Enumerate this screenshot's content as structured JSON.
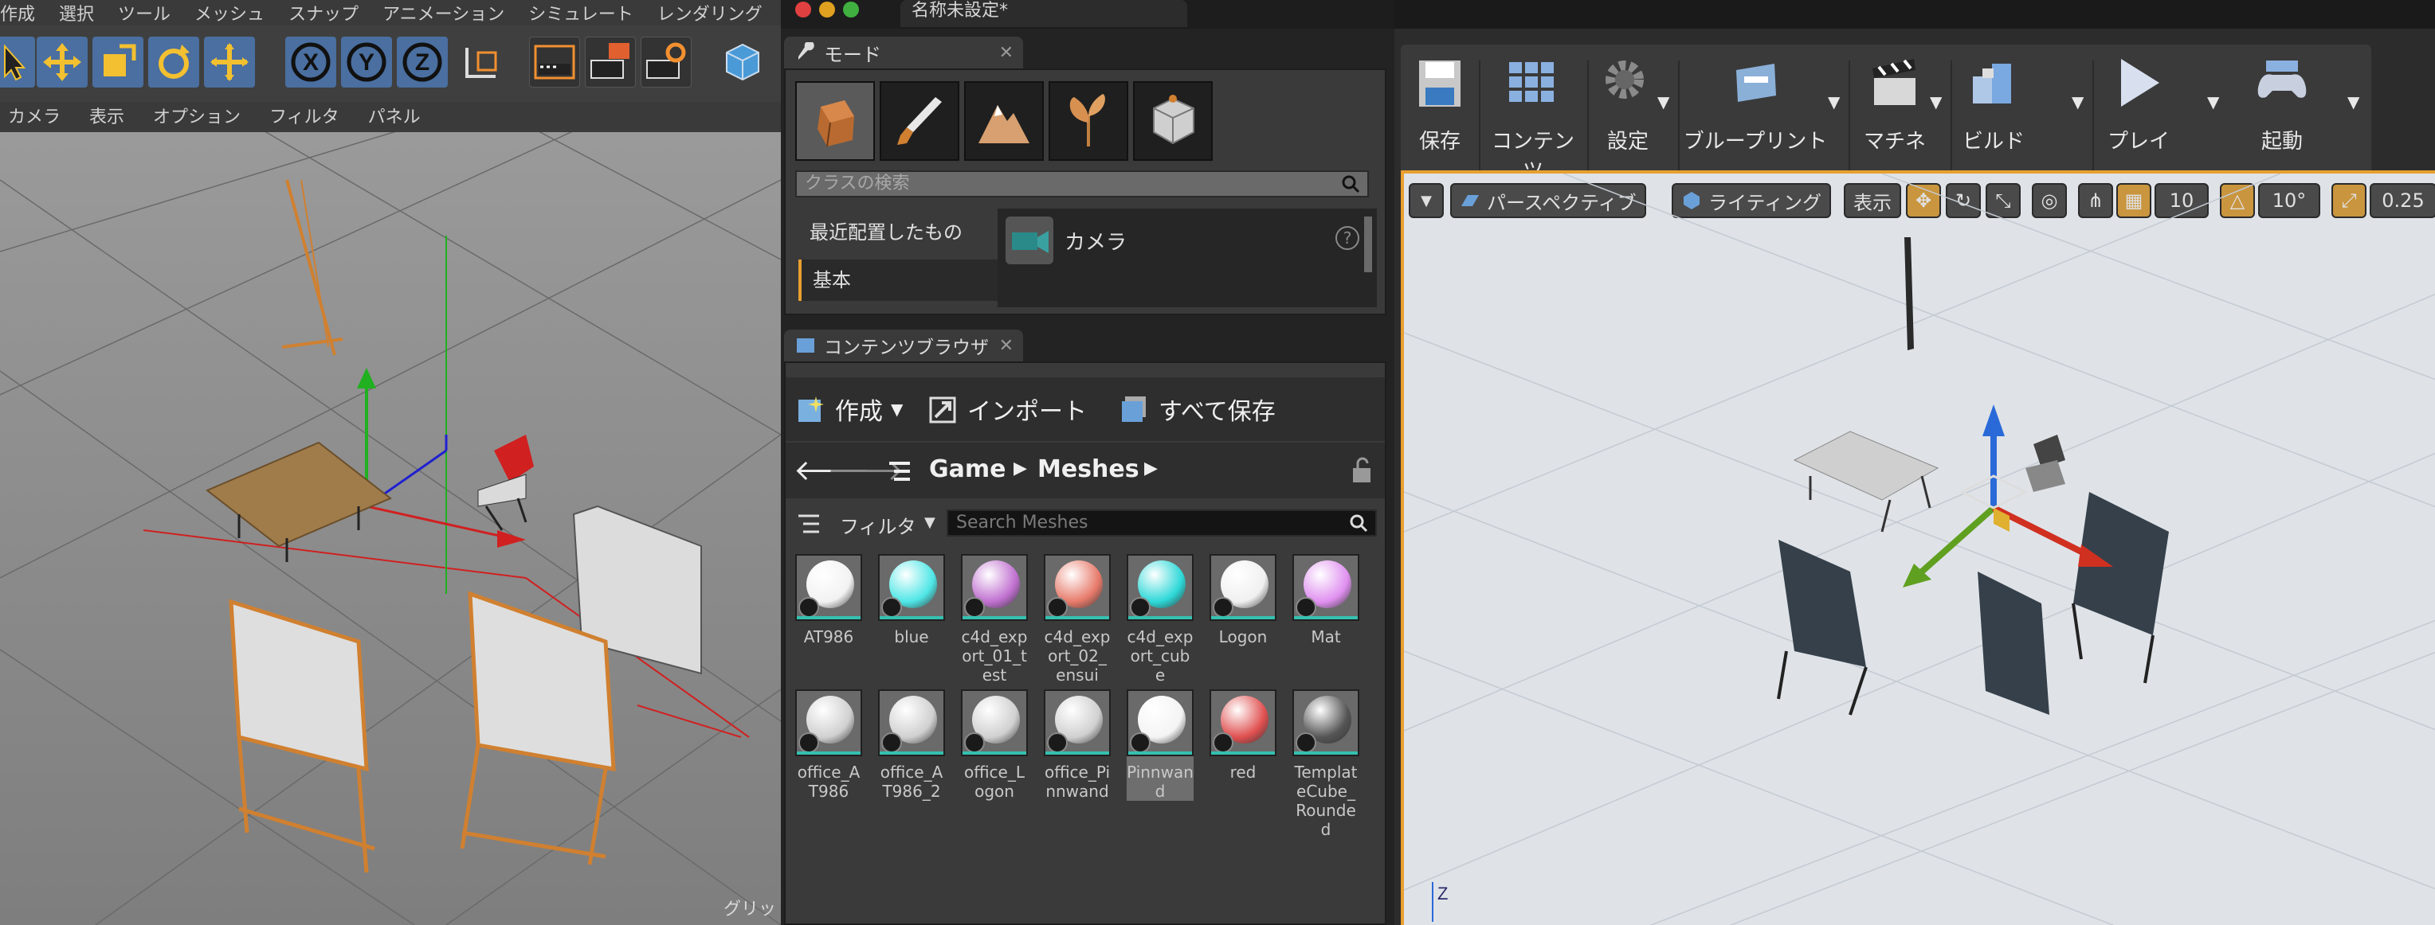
{
  "c4d": {
    "menu": [
      "作成",
      "選択",
      "ツール",
      "メッシュ",
      "スナップ",
      "アニメーション",
      "シミュレート",
      "レンダリング"
    ],
    "view_menu": [
      "カメラ",
      "表示",
      "オプション",
      "フィルタ",
      "パネル"
    ],
    "grid_label": "グリッ",
    "axis_x": "X",
    "axis_y": "Y",
    "axis_z": "Z"
  },
  "ue": {
    "doc_title": "名称未設定*",
    "modes_tab": "モード",
    "class_search_placeholder": "クラスの検索",
    "categories": [
      "最近配置したもの",
      "基本"
    ],
    "place_item": "カメラ",
    "help_glyph": "?",
    "content_browser_tab": "コンテンツブラウザ",
    "create_label": "作成",
    "import_label": "インポート",
    "save_all_label": "すべて保存",
    "path": [
      "Game",
      "Meshes"
    ],
    "filter_label": "フィルタ",
    "search_meshes_placeholder": "Search Meshes",
    "assets_row1": [
      {
        "label": "AT986",
        "color": "#f2f2f2"
      },
      {
        "label": "blue",
        "color": "#4fe6e6"
      },
      {
        "label": "c4d_export_01_test",
        "color": "#c070d0"
      },
      {
        "label": "c4d_export_02_ensui",
        "color": "#e77a6a"
      },
      {
        "label": "c4d_export_cube",
        "color": "#2ed8d8"
      },
      {
        "label": "Logon",
        "color": "#f0f0f0"
      },
      {
        "label": "Mat",
        "color": "#e090f0"
      }
    ],
    "assets_row2": [
      {
        "label": "office_AT986",
        "color": "#d0d0d0"
      },
      {
        "label": "office_AT986_2",
        "color": "#d0d0d0"
      },
      {
        "label": "office_Logon",
        "color": "#d0d0d0"
      },
      {
        "label": "office_Pinnwand",
        "color": "#d0d0d0"
      },
      {
        "label": "Pinnwand",
        "color": "#f4f4f4"
      },
      {
        "label": "red",
        "color": "#e05050"
      },
      {
        "label": "TemplateCube_Rounded",
        "color": "#555555"
      }
    ],
    "toolbar": [
      {
        "label": "保存"
      },
      {
        "label": "コンテンツ"
      },
      {
        "label": "設定"
      },
      {
        "label": "ブループリント"
      },
      {
        "label": "マチネ"
      },
      {
        "label": "ビルド"
      },
      {
        "label": "プレイ"
      },
      {
        "label": "起動"
      }
    ],
    "viewport": {
      "perspective": "パースペクティブ",
      "lighting": "ライティング",
      "show": "表示",
      "grid_snap": "10",
      "rot_snap": "10°",
      "scale_snap": "0.25",
      "axis_label": "Z"
    }
  }
}
